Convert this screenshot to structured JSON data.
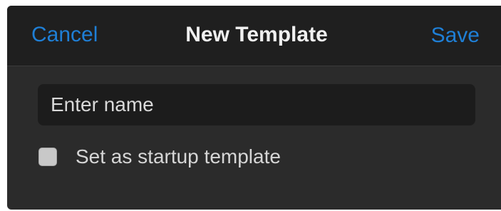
{
  "dialog": {
    "title": "New Template",
    "cancel_label": "Cancel",
    "save_label": "Save"
  },
  "name_field": {
    "value": "",
    "placeholder": "Enter name"
  },
  "startup_option": {
    "label": "Set as startup template",
    "checked": false
  },
  "colors": {
    "accent": "#1f7fd6",
    "header_bg": "#1f1f1f",
    "body_bg": "#2b2b2b",
    "field_bg": "#1c1c1c"
  }
}
